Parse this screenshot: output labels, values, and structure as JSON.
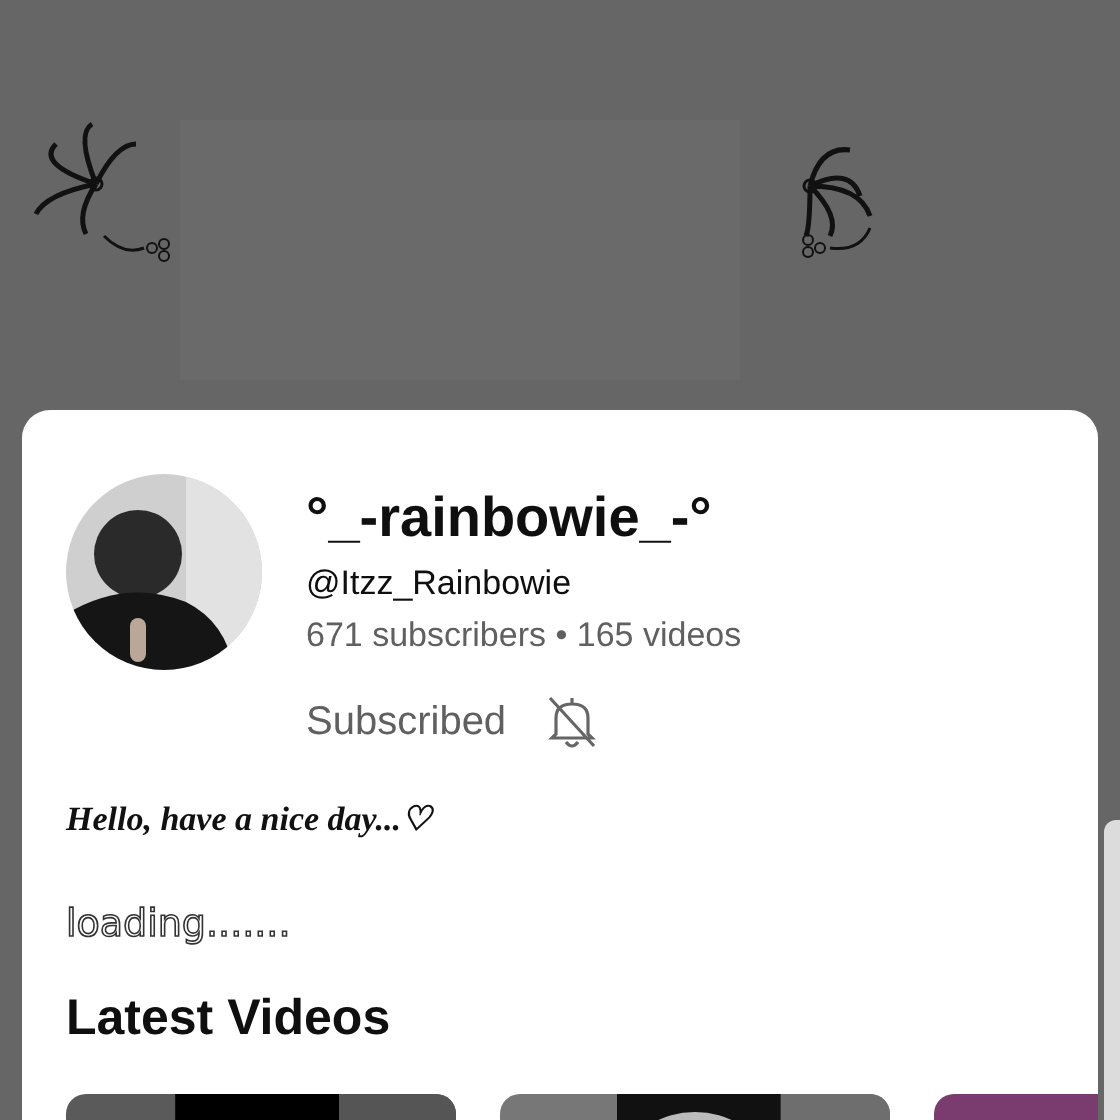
{
  "channel": {
    "name": "°_-rainbowie_-°",
    "handle": "@Itzz_Rainbowie",
    "stats": "671 subscribers • 165 videos",
    "subscribe_button": "Subscribed",
    "notifications_on": false
  },
  "description": "Hello, have a nice day...♡",
  "status_text": "loading.......",
  "section_title": "Latest Videos"
}
